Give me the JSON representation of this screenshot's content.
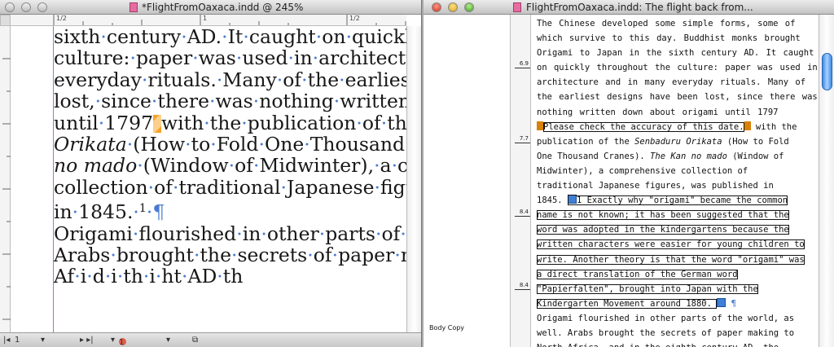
{
  "layout_window": {
    "title": "*FlightFromOaxaca.indd @ 245%",
    "ruler_marks": [
      "1/2",
      "1",
      "1/2",
      "1/2"
    ],
    "lines": [
      [
        "sixth",
        "century",
        "AD.",
        "It",
        "caught",
        "on",
        "quickly",
        "thr"
      ],
      [
        "culture:",
        "paper",
        "was",
        "used",
        "in",
        "architecture",
        "and"
      ],
      [
        "everyday",
        "rituals.",
        "Many",
        "of",
        "the",
        "earliest",
        "desig"
      ],
      [
        "lost,",
        "since",
        "there",
        "was",
        "nothing",
        "written",
        "down"
      ],
      [
        "until",
        "1797",
        "with",
        "the",
        "publication",
        "of",
        "the",
        "Sen"
      ],
      [
        "Orikata",
        "(How",
        "to",
        "Fold",
        "One",
        "Thousand",
        "Cra"
      ],
      [
        "no mado",
        "(Window",
        "of",
        "Midwinter),",
        "a",
        "compr"
      ],
      [
        "collection",
        "of",
        "traditional",
        "Japanese",
        "figures,",
        "w"
      ],
      [
        "in",
        "1845.",
        "1",
        "¶"
      ],
      [
        "Origami",
        "flourished",
        "in",
        "other",
        "parts",
        "of",
        "the",
        "wo"
      ],
      [
        "Arabs",
        "brought",
        "the",
        "secrets",
        "of",
        "paper",
        "making"
      ],
      [
        "Af",
        "i",
        "d",
        "i",
        "th",
        "i",
        "ht",
        "AD",
        "th"
      ]
    ],
    "status": {
      "page": "1",
      "errors": "1 error"
    }
  },
  "story_window": {
    "title": "FlightFromOaxaca.indd: The flight back from...",
    "depth_marks": [
      "6.9",
      "7.7",
      "8.4",
      "8.4"
    ],
    "paragraph_style": "Body Copy",
    "lines": [
      "The Chinese developed some simple forms, some of",
      "which survive to this day. Buddhist monks brought",
      "Origami to Japan in the sixth century AD. It caught",
      "on quickly throughout the culture: paper was used in",
      "architecture and in many everyday rituals. Many of",
      "the earliest designs have been lost, since there was",
      "nothing written down about origami until 1797",
      "Please check the accuracy of this date.",
      "with the",
      "publication of the Senbaduru Orikata (How to Fold",
      "One Thousand Cranes). The Kan no mado (Window of",
      "Midwinter), a comprehensive collection of",
      "traditional Japanese figures, was published in",
      "1845.",
      "1 Exactly why \"origami\" became the common",
      "name is not known; it has been suggested that the",
      "word was adopted in the kindergartens because the",
      "written characters were easier for young children to",
      "write. Another theory is that the word \"origami\" was",
      "a direct translation of the German word",
      "\"Papierfalten\", brought into Japan with the",
      "Kindergarten Movement around 1880.",
      "¶",
      "Origami flourished in other parts of the world, as",
      "well. Arabs brought the secrets of paper making to",
      "North Africa, and in the eighth century AD, the"
    ]
  },
  "colors": {
    "accent_blue": "#3f7fd6",
    "note_orange": "#f7a326",
    "margin_purple": "#b36ad1",
    "error_red": "#e05b4a"
  }
}
